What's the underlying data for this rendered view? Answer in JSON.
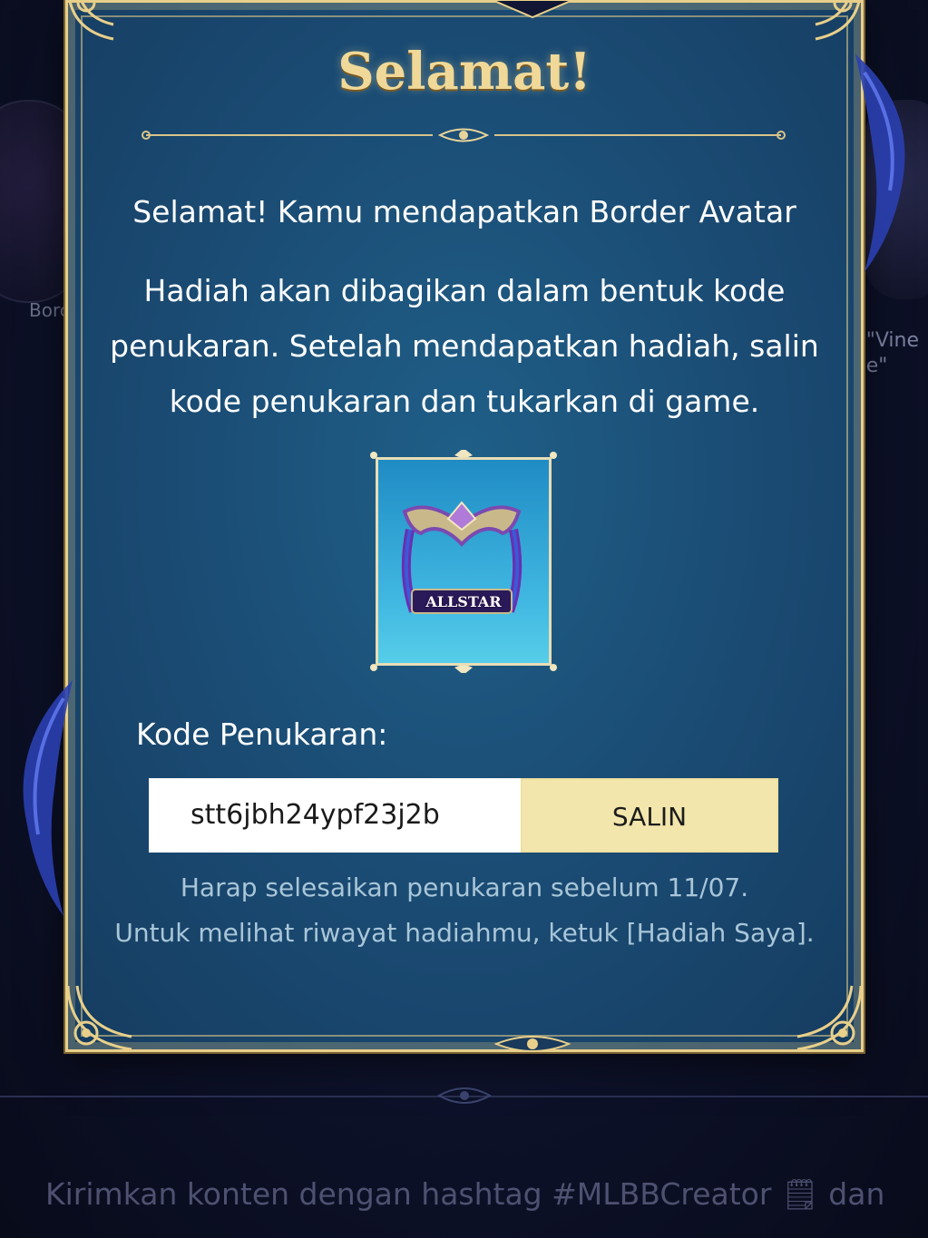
{
  "background": {
    "left_card_label": "Borc",
    "right_card_label_line1": "\"Vine",
    "right_card_label_line2": "e\"",
    "footer_text": "Kirimkan konten dengan hashtag #MLBBCreator 🗒 dan"
  },
  "modal": {
    "title": "Selamat!",
    "message_line1": "Selamat! Kamu mendapatkan Border Avatar",
    "message_line2": "Hadiah akan dibagikan dalam bentuk kode penukaran. Setelah mendapatkan hadiah, salin kode penukaran dan tukarkan di game.",
    "reward": {
      "icon": "allstar-border-avatar-icon",
      "label": "ALLSTAR"
    },
    "code_label": "Kode Penukaran:",
    "code_value": "stt6jbh24ypf23j2b",
    "copy_button": "SALIN",
    "note_line1": "Harap selesaikan penukaran sebelum 11/07.",
    "note_line2": "Untuk melihat riwayat hadiahmu, ketuk [Hadiah Saya]."
  },
  "colors": {
    "modal_bg": "#1a4a72",
    "gold_border": "#e8cf8a",
    "title_gold": "#f0d998",
    "copy_button_bg": "#f3e6ad",
    "note_text": "#a9c6d8"
  }
}
